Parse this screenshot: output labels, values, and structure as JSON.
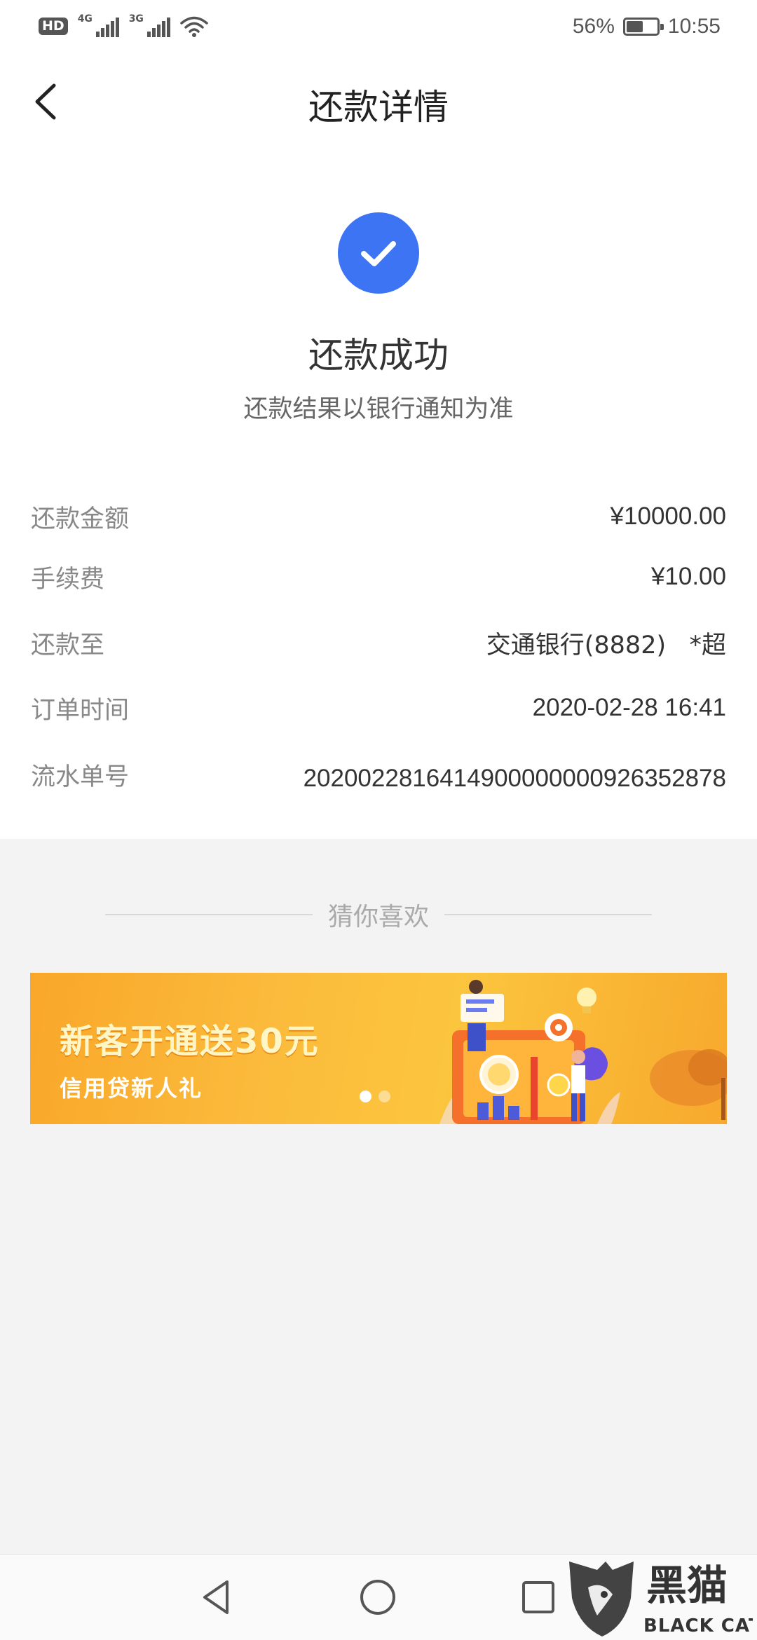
{
  "status_bar": {
    "hd": "HD",
    "sim1_network": "4G",
    "sim2_network": "3G",
    "battery": "56%",
    "battery_level": 0.56,
    "time": "10:55"
  },
  "header": {
    "title": "还款详情",
    "back_icon": "chevron-left-icon"
  },
  "result": {
    "icon": "check-circle-icon",
    "icon_color": "#3d74f4",
    "title": "还款成功",
    "subtitle": "还款结果以银行通知为准"
  },
  "details": [
    {
      "label": "还款金额",
      "value": "¥10000.00"
    },
    {
      "label": "手续费",
      "value": "¥10.00"
    },
    {
      "label": "还款至",
      "value": "交通银行(8882)   *超"
    },
    {
      "label": "订单时间",
      "value": "2020-02-28 16:41"
    },
    {
      "label": "流水单号",
      "value": "2020022816414900000000926352878"
    }
  ],
  "recommend": {
    "heading": "猜你喜欢",
    "banner": {
      "title": "新客开通送30元",
      "subtitle": "信用贷新人礼",
      "pages": 2,
      "active_page": 1
    }
  },
  "system_nav": [
    "back-triangle-icon",
    "home-circle-icon",
    "recent-square-icon"
  ],
  "watermark": {
    "chinese": "黑猫",
    "english": "BLACK CAT"
  }
}
